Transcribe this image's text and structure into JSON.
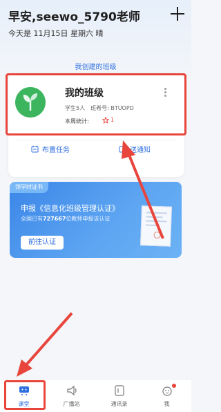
{
  "header": {
    "greeting": "早安,seewo_5790老师",
    "date_line": "今天是 11月15日 星期六 晴"
  },
  "section_title": "我创建的班级",
  "class_card": {
    "name": "我的班级",
    "students": "学生5人",
    "class_id": "班希号: BTUOPD",
    "week_stats_label": "本周统计:",
    "week_stats_value": "1"
  },
  "actions": {
    "assign_task": "布置任务",
    "send_notice": "送通知"
  },
  "banner": {
    "tag": "领学时证书",
    "title": "申报《信息化班级管理认证》",
    "subtitle_prefix": "全国已有",
    "subtitle_count": "727667",
    "subtitle_suffix": "位教师申报该认证",
    "button": "前往认证"
  },
  "tabs": [
    {
      "label": "课堂",
      "icon": "classroom-icon",
      "active": true
    },
    {
      "label": "广播站",
      "icon": "broadcast-icon",
      "active": false
    },
    {
      "label": "通讯录",
      "icon": "contacts-icon",
      "active": false
    },
    {
      "label": "我",
      "icon": "profile-icon",
      "active": false
    }
  ],
  "colors": {
    "accent": "#2f6fde",
    "highlight_red": "#e8453c",
    "class_avatar_green": "#3cb55e"
  }
}
